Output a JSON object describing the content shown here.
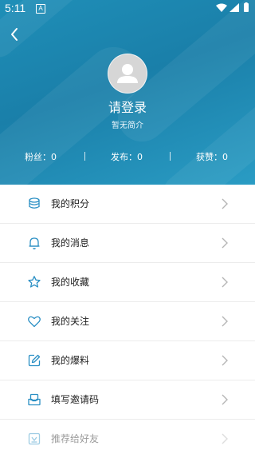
{
  "status_bar": {
    "time": "5:11",
    "notification_letter": "A"
  },
  "profile": {
    "login_prompt": "请登录",
    "intro": "暂无简介"
  },
  "stats": {
    "fans_label": "粉丝：",
    "fans_value": "0",
    "posts_label": "发布：",
    "posts_value": "0",
    "likes_label": "获赞：",
    "likes_value": "0"
  },
  "menu": {
    "items": [
      {
        "label": "我的积分",
        "icon": "coins-stack-icon"
      },
      {
        "label": "我的消息",
        "icon": "bell-icon"
      },
      {
        "label": "我的收藏",
        "icon": "star-icon"
      },
      {
        "label": "我的关注",
        "icon": "heart-icon"
      },
      {
        "label": "我的爆料",
        "icon": "edit-icon"
      },
      {
        "label": "填写邀请码",
        "icon": "inbox-icon"
      },
      {
        "label": "推荐给好友",
        "icon": "share-card-icon"
      }
    ]
  },
  "colors": {
    "header_bg": "#1f8fb8",
    "icon_accent": "#2a8fc4",
    "menu_bg": "#ffffff",
    "chevron": "#b5b5b5"
  }
}
